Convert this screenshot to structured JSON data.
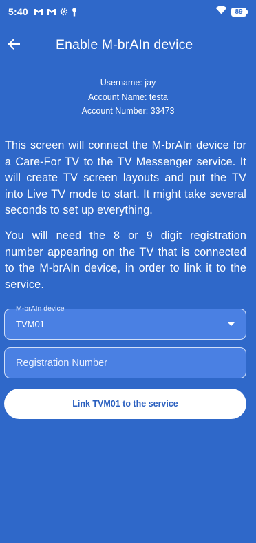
{
  "status_bar": {
    "time": "5:40",
    "battery_level": "89",
    "icons": [
      "gmail-icon",
      "gmail-icon",
      "settings-gear-icon",
      "lock-key-icon",
      "wifi-icon",
      "battery-icon"
    ]
  },
  "app_bar": {
    "title": "Enable M-brAIn device",
    "back_icon": "arrow-back-icon"
  },
  "account": {
    "username": "Username: jay",
    "account_name": "Account Name: testa",
    "account_number": "Account Number: 33473"
  },
  "description": {
    "paragraph_1": "This screen will connect the M-brAIn device for a Care-For TV to the TV Messenger service. It will create TV screen layouts and put the TV into Live TV mode to start. It might take several seconds to set up everything.",
    "paragraph_2": "You will need the 8 or 9 digit registration number appearing on the TV that is connected to the M-brAIn device, in order to link it to the service."
  },
  "form": {
    "device_label": "M-brAIn device",
    "device_value": "TVM01",
    "registration_value": "",
    "registration_placeholder": "Registration Number",
    "link_button_label": "Link TVM01 to the service"
  },
  "colors": {
    "background": "#2f68c9",
    "field_fill": "#4a80e3",
    "button_bg": "#ffffff",
    "button_text": "#2a5fbf"
  }
}
